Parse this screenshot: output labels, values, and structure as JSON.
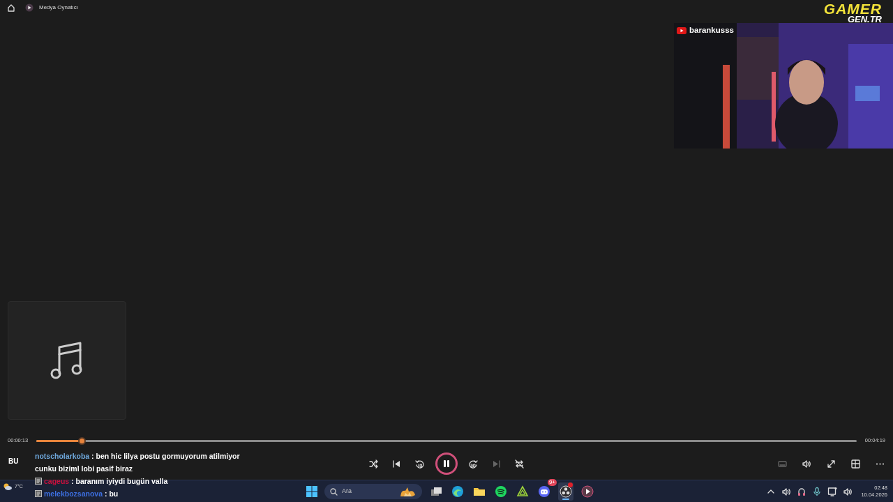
{
  "title_bar": {
    "title": "Medya Oynatıcı"
  },
  "overlay": {
    "logo_top": "GAMER",
    "logo_bottom": "GEN.TR",
    "channel": "barankusss",
    "stream_text": "BU"
  },
  "player": {
    "elapsed": "00:00:13",
    "duration": "00:04:19",
    "level": 0.055,
    "playing": true
  },
  "controls": [
    {
      "kind": "shuffle",
      "disabled": false
    },
    {
      "kind": "previous",
      "disabled": false
    },
    {
      "kind": "back10",
      "disabled": false
    },
    {
      "kind": "playpause"
    },
    {
      "kind": "forward30",
      "disabled": false
    },
    {
      "kind": "next",
      "disabled": true
    },
    {
      "kind": "repeat",
      "disabled": false
    }
  ],
  "right_controls": [
    {
      "kind": "captions",
      "disabled": true
    },
    {
      "kind": "volume",
      "disabled": false
    },
    {
      "kind": "fullscreen",
      "disabled": false
    },
    {
      "kind": "miniplayer",
      "disabled": false
    },
    {
      "kind": "more",
      "disabled": false
    }
  ],
  "chat": [
    {
      "user": "notscholarkoba",
      "color": "#6fa8dc",
      "badge": false,
      "message": ": ben hic lilya postu gormuyorum atilmiyor cunku biziml lobi pasif biraz"
    },
    {
      "user": "cageus",
      "color": "#c8103c",
      "badge": true,
      "message": ": baranım iyiydi bugün valla"
    },
    {
      "user": "melekbozsanova",
      "color": "#3d6fe0",
      "badge": true,
      "message": ": bu"
    }
  ],
  "taskbar": {
    "weather": "7°C",
    "search_placeholder": "Ara",
    "apps": [
      {
        "kind": "taskview",
        "active": false
      },
      {
        "kind": "edge",
        "active": false
      },
      {
        "kind": "folder",
        "active": false
      },
      {
        "kind": "spotify",
        "active": false
      },
      {
        "kind": "nvidia",
        "active": false
      },
      {
        "kind": "discord",
        "active": false,
        "badge": "9+"
      },
      {
        "kind": "obs",
        "active": true,
        "dot": true
      },
      {
        "kind": "player",
        "active": false
      }
    ],
    "tray": [
      {
        "kind": "chevron"
      },
      {
        "kind": "volume"
      },
      {
        "kind": "headset"
      },
      {
        "kind": "mic"
      },
      {
        "kind": "device"
      },
      {
        "kind": "volume"
      }
    ],
    "time": "02:48",
    "date": "10.04.2026"
  }
}
